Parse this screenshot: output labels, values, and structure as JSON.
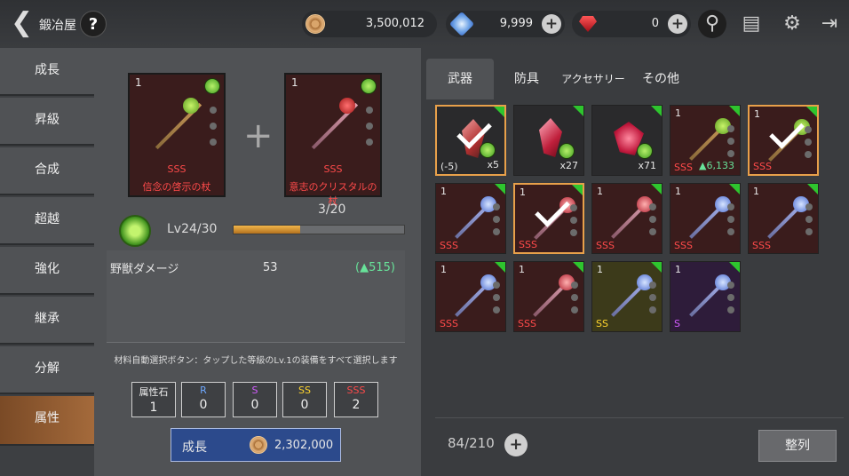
{
  "header": {
    "title": "鍛冶屋",
    "help": "?",
    "gold": "3,500,012",
    "blue_gems": "9,999",
    "red_gems": "0"
  },
  "sidebar": {
    "items": [
      {
        "label": "成長"
      },
      {
        "label": "昇級"
      },
      {
        "label": "合成"
      },
      {
        "label": "超越"
      },
      {
        "label": "強化"
      },
      {
        "label": "継承"
      },
      {
        "label": "分解"
      },
      {
        "label": "属性",
        "active": true
      }
    ]
  },
  "main_card": {
    "count": "1",
    "grade": "SSS",
    "name": "信念の啓示の杖"
  },
  "material_card": {
    "count": "1",
    "grade": "SSS",
    "name": "意志のクリスタルの杖"
  },
  "progress": "3/20",
  "level": {
    "text": "Lv24/30",
    "fill": 0.39
  },
  "stat": {
    "label": "野獣ダメージ",
    "value": "53",
    "delta": "(▲515)"
  },
  "note": "材料自動選択ボタン：タップした等級のLv.1の装備をすべて選択します",
  "grades": [
    {
      "label": "属性石",
      "count": "1",
      "color": "#eeeeee"
    },
    {
      "label": "R",
      "count": "0",
      "color": "#6ea8ff"
    },
    {
      "label": "S",
      "count": "0",
      "color": "#d35cff"
    },
    {
      "label": "SS",
      "count": "0",
      "color": "#ffd52e"
    },
    {
      "label": "SSS",
      "count": "2",
      "color": "#ff4a4a"
    }
  ],
  "grow_button": {
    "label": "成長",
    "cost": "2,302,000"
  },
  "tabs": [
    {
      "label": "武器"
    },
    {
      "label": "防具"
    },
    {
      "label": "アクセサリー"
    },
    {
      "label": "その他"
    }
  ],
  "inventory": [
    {
      "kind": "stone",
      "count": "x5",
      "level": "(-5)",
      "selected": true
    },
    {
      "kind": "crystal",
      "count": "x27"
    },
    {
      "kind": "ruby",
      "count": "x71"
    },
    {
      "kind": "staff",
      "n": "1",
      "grade": "SSS",
      "extra": "▲6,133"
    },
    {
      "kind": "staff",
      "n": "1",
      "grade": "SSS",
      "selected": true
    },
    {
      "kind": "staff-blue",
      "n": "1",
      "grade": "SSS"
    },
    {
      "kind": "staff-pink",
      "n": "1",
      "grade": "SSS",
      "selected": true
    },
    {
      "kind": "staff-pink",
      "n": "1",
      "grade": "SSS"
    },
    {
      "kind": "staff-blue",
      "n": "1",
      "grade": "SSS"
    },
    {
      "kind": "staff-blue",
      "n": "1",
      "grade": "SSS"
    },
    {
      "kind": "staff-blue",
      "n": "1",
      "grade": "SSS"
    },
    {
      "kind": "staff-pink",
      "n": "1",
      "grade": "SSS"
    },
    {
      "kind": "staff-blue",
      "n": "1",
      "grade": "SS"
    },
    {
      "kind": "staff-blue",
      "n": "1",
      "grade": "S"
    }
  ],
  "inventory_count": "84/210",
  "sort_label": "整列"
}
